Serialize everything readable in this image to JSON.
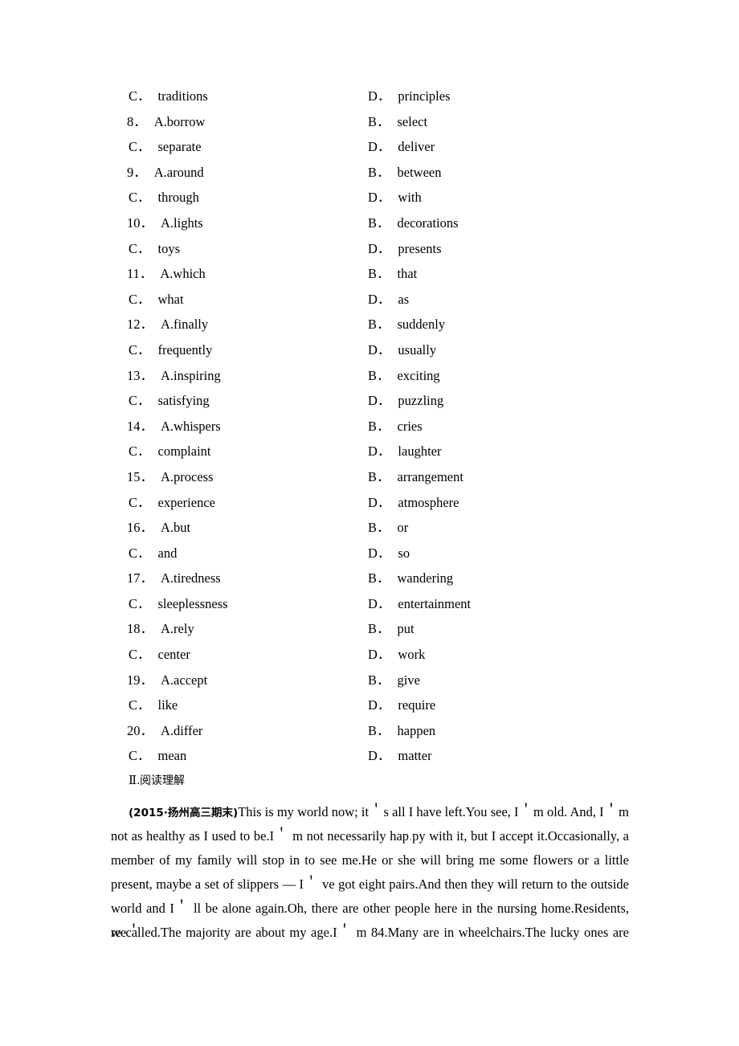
{
  "document": {
    "type": "exam-worksheet-page",
    "language": "en-zh"
  },
  "cloze_options": {
    "rows": [
      {
        "left": {
          "label": "C．",
          "text": "traditions"
        },
        "right": {
          "label": "D．",
          "text": "principles"
        },
        "numbered": false
      },
      {
        "left": {
          "label": "8．",
          "text": "A.borrow"
        },
        "right": {
          "label": "B．",
          "text": "select"
        },
        "numbered": true
      },
      {
        "left": {
          "label": "C．",
          "text": "separate"
        },
        "right": {
          "label": "D．",
          "text": "deliver"
        },
        "numbered": false
      },
      {
        "left": {
          "label": "9．",
          "text": "A.around"
        },
        "right": {
          "label": "B．",
          "text": "between"
        },
        "numbered": true
      },
      {
        "left": {
          "label": "C．",
          "text": "through"
        },
        "right": {
          "label": "D．",
          "text": "with"
        },
        "numbered": false
      },
      {
        "left": {
          "label": "10．",
          "text": "A.lights"
        },
        "right": {
          "label": "B．",
          "text": "decorations"
        },
        "numbered": true
      },
      {
        "left": {
          "label": "C．",
          "text": "toys"
        },
        "right": {
          "label": "D．",
          "text": "presents"
        },
        "numbered": false
      },
      {
        "left": {
          "label": "11．",
          "text": "A.which"
        },
        "right": {
          "label": "B．",
          "text": "that"
        },
        "numbered": true
      },
      {
        "left": {
          "label": "C．",
          "text": "what"
        },
        "right": {
          "label": "D．",
          "text": "as"
        },
        "numbered": false
      },
      {
        "left": {
          "label": "12．",
          "text": "A.finally"
        },
        "right": {
          "label": "B．",
          "text": "suddenly"
        },
        "numbered": true
      },
      {
        "left": {
          "label": "C．",
          "text": "frequently"
        },
        "right": {
          "label": "D．",
          "text": "usually"
        },
        "numbered": false
      },
      {
        "left": {
          "label": "13．",
          "text": "A.inspiring"
        },
        "right": {
          "label": "B．",
          "text": "exciting"
        },
        "numbered": true
      },
      {
        "left": {
          "label": "C．",
          "text": "satisfying"
        },
        "right": {
          "label": "D．",
          "text": "puzzling"
        },
        "numbered": false
      },
      {
        "left": {
          "label": "14．",
          "text": "A.whispers"
        },
        "right": {
          "label": "B．",
          "text": "cries"
        },
        "numbered": true
      },
      {
        "left": {
          "label": "C．",
          "text": "complaint"
        },
        "right": {
          "label": "D．",
          "text": "laughter"
        },
        "numbered": false
      },
      {
        "left": {
          "label": "15．",
          "text": "A.process"
        },
        "right": {
          "label": "B．",
          "text": "arrangement"
        },
        "numbered": true
      },
      {
        "left": {
          "label": "C．",
          "text": "experience"
        },
        "right": {
          "label": "D．",
          "text": "atmosphere"
        },
        "numbered": false
      },
      {
        "left": {
          "label": "16．",
          "text": "A.but"
        },
        "right": {
          "label": "B．",
          "text": "or"
        },
        "numbered": true
      },
      {
        "left": {
          "label": "C．",
          "text": "and"
        },
        "right": {
          "label": "D．",
          "text": "so"
        },
        "numbered": false
      },
      {
        "left": {
          "label": "17．",
          "text": "A.tiredness"
        },
        "right": {
          "label": "B．",
          "text": "wandering"
        },
        "numbered": true
      },
      {
        "left": {
          "label": "C．",
          "text": "sleeplessness"
        },
        "right": {
          "label": "D．",
          "text": "entertainment"
        },
        "numbered": false
      },
      {
        "left": {
          "label": "18．",
          "text": "A.rely"
        },
        "right": {
          "label": "B．",
          "text": "put"
        },
        "numbered": true
      },
      {
        "left": {
          "label": "C．",
          "text": "center"
        },
        "right": {
          "label": "D．",
          "text": "work"
        },
        "numbered": false
      },
      {
        "left": {
          "label": "19．",
          "text": "A.accept"
        },
        "right": {
          "label": "B．",
          "text": "give"
        },
        "numbered": true
      },
      {
        "left": {
          "label": "C．",
          "text": "like"
        },
        "right": {
          "label": "D．",
          "text": "require"
        },
        "numbered": false
      },
      {
        "left": {
          "label": "20．",
          "text": "A.differ"
        },
        "right": {
          "label": "B．",
          "text": "happen"
        },
        "numbered": true
      },
      {
        "left": {
          "label": "C．",
          "text": "mean"
        },
        "right": {
          "label": "D．",
          "text": "matter"
        },
        "numbered": false
      }
    ]
  },
  "reading_section": {
    "heading": "Ⅱ.阅读理解",
    "heading_numeral": "Ⅱ.",
    "heading_chinese": "阅读理解",
    "source_tag": "(2015·扬州高三期末)",
    "passage_lines": [
      "This is my world now; it＇s all I have left.You see, I＇m old. And, I＇m",
      "not as healthy as I used to be.I＇ m not necessarily hap.py with it, but I accept it.Occasionally, a",
      "member of my family will stop in to see me.He or she will bring me some flowers or a little",
      "present, maybe a set of slippers — I＇ ve got eight pairs.And then they will return to the outside",
      "world and I＇ ll be alone again.Oh, there are other people here in the nursing home.Residents, we＇",
      "re called.The majority are about my age.I＇ m 84.Many are in wheelchairs.The lucky ones are"
    ],
    "passage_line_1_text": "This is my world now; it",
    "passage_line_1_b": "s all I have left.You see, I",
    "passage_line_1_c": "m old. And, I",
    "passage_line_1_d": "m",
    "passage_line_2_a": "not as healthy as I used to be.I",
    "passage_line_2_b": " m not necessarily hap",
    "passage_line_2_artifact": ".",
    "passage_line_2_c": "py with it, but I accept it.Occasionally, a",
    "passage_line_3": "member of my family will stop in to see me.He or she will bring me some flowers or a little",
    "passage_line_4_a": "present, maybe a set of slippers — I",
    "passage_line_4_b": " ve got eight pairs.And then they will return to the outside",
    "passage_line_5_a": "world and I",
    "passage_line_5_b": " ll be alone again.Oh, there are other people here in the nursing home.Residents, we",
    "passage_line_6_a": "re called.The majority are about my age.I",
    "passage_line_6_b": " m 84.Many are in wheelchairs.The lucky ones are",
    "apostrophe": "＇"
  },
  "colors": {
    "page_background": "#ffffff",
    "text": "#000000",
    "scan_artifact": "#d79b26"
  }
}
